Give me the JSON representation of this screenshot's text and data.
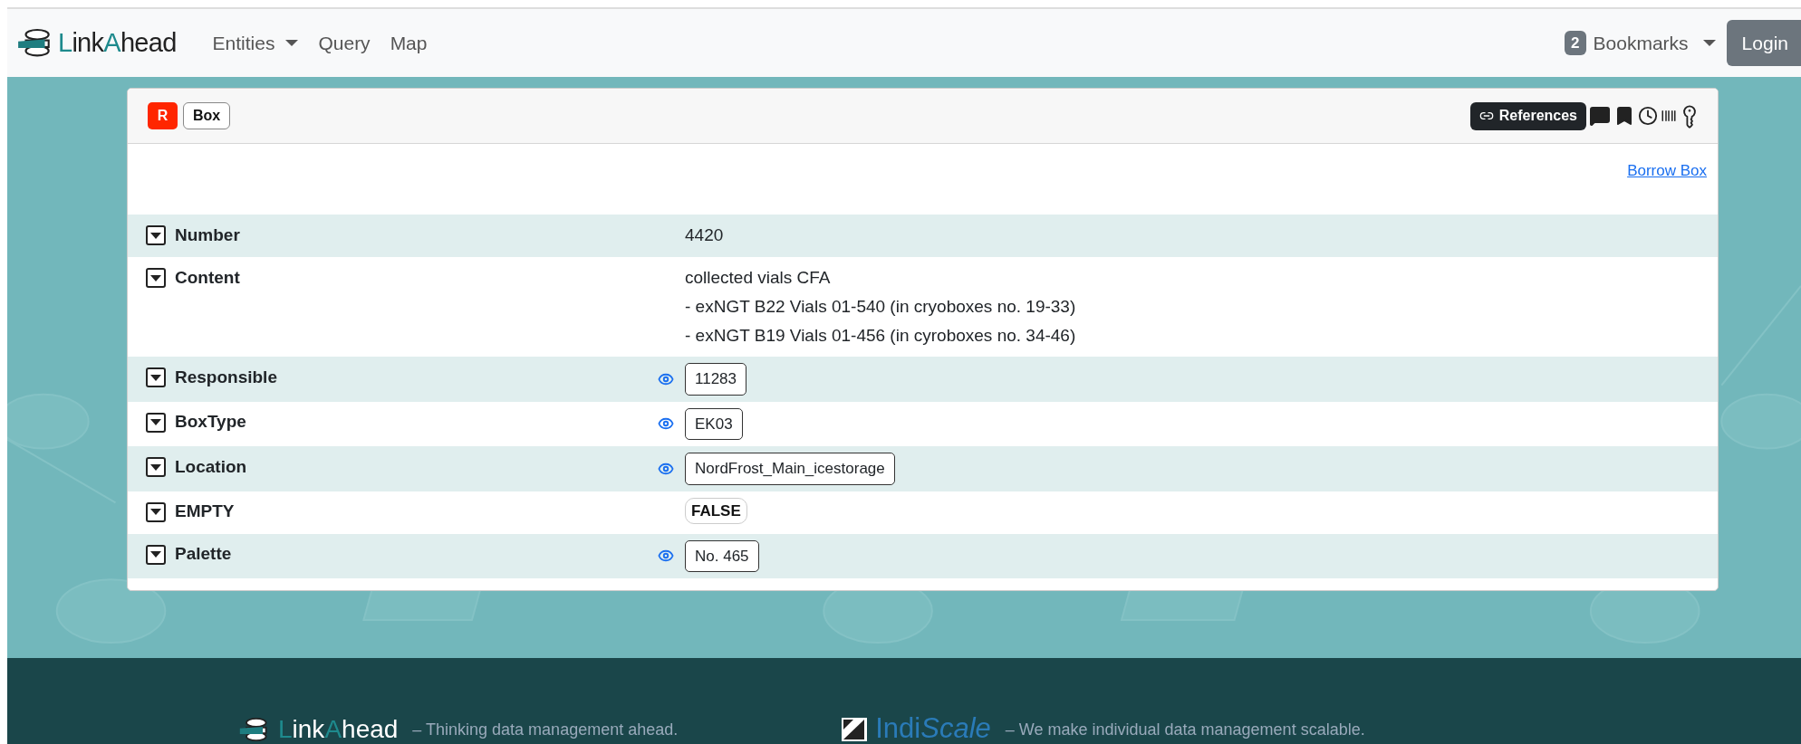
{
  "navbar": {
    "logo": [
      {
        "text": "L",
        "accent": true
      },
      {
        "text": "ink",
        "accent": false
      },
      {
        "text": "A",
        "accent": true
      },
      {
        "text": "head",
        "accent": false
      }
    ],
    "menu": [
      {
        "label": "Entities",
        "dropdown": true
      },
      {
        "label": "Query",
        "dropdown": false
      },
      {
        "label": "Map",
        "dropdown": false
      }
    ],
    "bookmarks": {
      "count": "2",
      "label": "Bookmarks"
    },
    "login": "Login"
  },
  "entity": {
    "role": "R",
    "name": "Box",
    "references": "References",
    "borrow_link": "Borrow Box",
    "properties": [
      {
        "name": "Number",
        "kind": "text",
        "values": [
          "4420"
        ]
      },
      {
        "name": "Content",
        "kind": "text",
        "values": [
          "collected vials CFA",
          "- exNGT B22 Vials 01-540 (in cryoboxes no. 19-33)",
          "- exNGT B19 Vials 01-456 (in cyroboxes no. 34-46)"
        ]
      },
      {
        "name": "Responsible",
        "kind": "reference",
        "values": [
          "11283"
        ]
      },
      {
        "name": "BoxType",
        "kind": "reference",
        "values": [
          "EK03"
        ]
      },
      {
        "name": "Location",
        "kind": "reference",
        "values": [
          "NordFrost_Main_icestorage"
        ]
      },
      {
        "name": "EMPTY",
        "kind": "boolean",
        "values": [
          "FALSE"
        ]
      },
      {
        "name": "Palette",
        "kind": "reference",
        "values": [
          "No. 465"
        ]
      }
    ]
  },
  "footer": {
    "items": [
      {
        "kind": "linkahead",
        "logo": [
          {
            "text": "L",
            "accent": true
          },
          {
            "text": "ink",
            "accent": false
          },
          {
            "text": "A",
            "accent": true
          },
          {
            "text": "head",
            "accent": false
          }
        ],
        "tagline": "– Thinking data management ahead."
      },
      {
        "kind": "indiscale",
        "logo": [
          {
            "text": "Indi",
            "italic": false
          },
          {
            "text": "Scale",
            "italic": true
          }
        ],
        "tagline": "– We make individual data management scalable."
      }
    ]
  }
}
